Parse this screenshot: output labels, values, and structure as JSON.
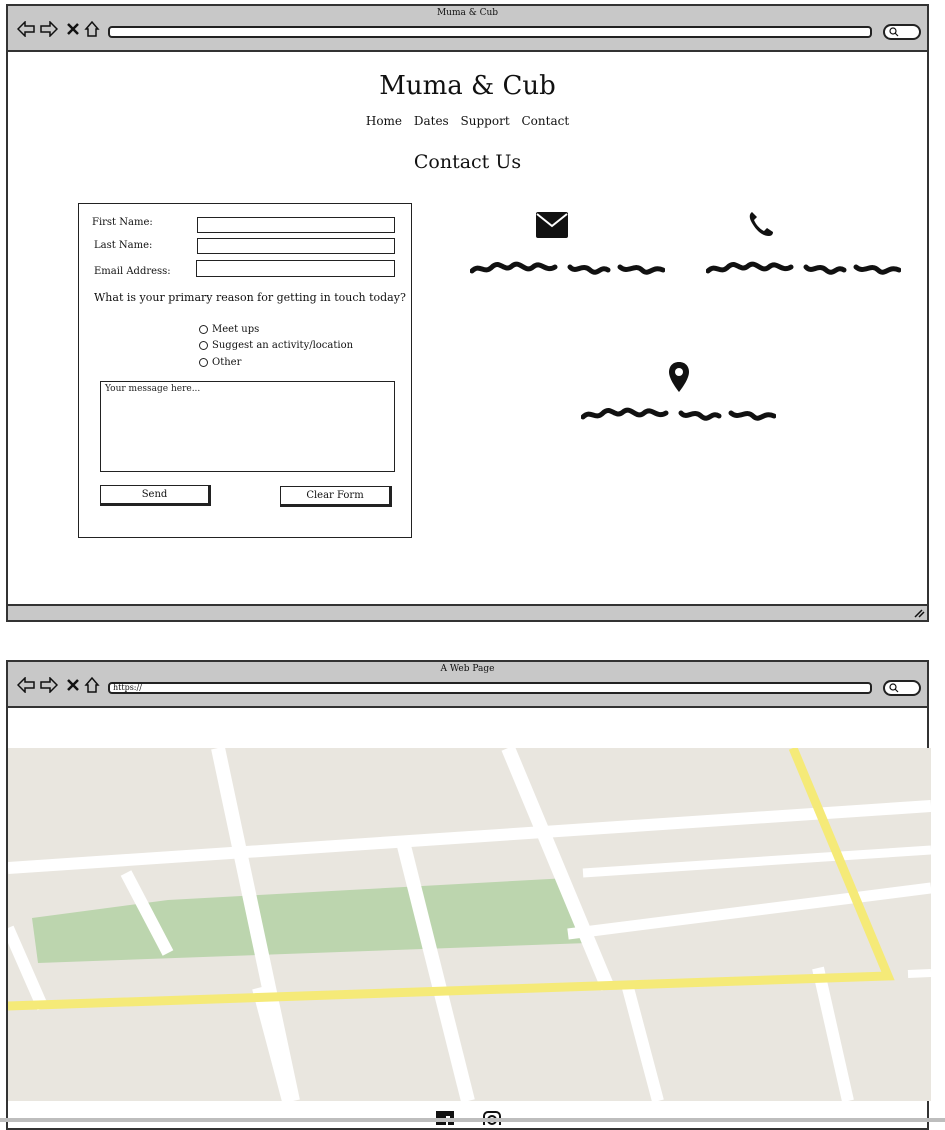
{
  "window1": {
    "title": "Muma & Cub",
    "url": "",
    "site_title": "Muma & Cub",
    "nav": [
      "Home",
      "Dates",
      "Support",
      "Contact"
    ],
    "heading": "Contact Us",
    "form": {
      "first_name_label": "First Name:",
      "last_name_label": "Last Name:",
      "email_label": "Email Address:",
      "first_name_value": "",
      "last_name_value": "",
      "email_value": "",
      "question": "What is your primary reason for getting in touch today?",
      "options": [
        "Meet ups",
        "Suggest an activity/location",
        "Other"
      ],
      "message_placeholder": "Your message here...",
      "send_label": "Send",
      "clear_label": "Clear Form"
    },
    "contact_icons": [
      "envelope-icon",
      "phone-icon",
      "location-pin-icon"
    ]
  },
  "window2": {
    "title": "A Web Page",
    "url": "https://",
    "footer_icons": [
      "facebook-icon",
      "instagram-icon"
    ]
  },
  "colors": {
    "chrome": "#c8c8c8",
    "map_land": "#e9e6df",
    "map_park": "#bcd5ae",
    "map_highway": "#f5ea78",
    "map_road": "#ffffff"
  }
}
